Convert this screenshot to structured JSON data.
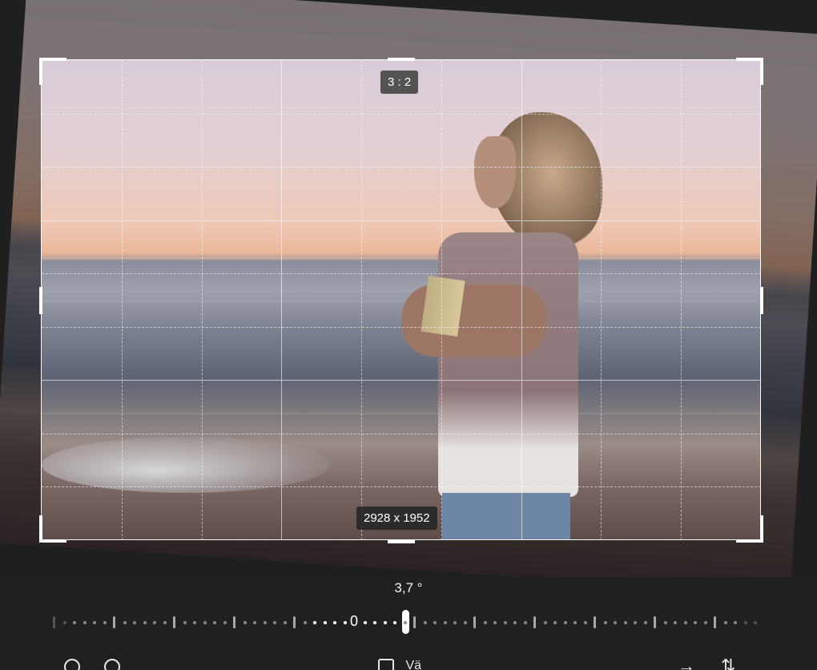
{
  "crop": {
    "aspect_ratio": "3 : 2",
    "dimensions": "2928 x 1952"
  },
  "straighten": {
    "angle_label": "3,7 °",
    "zero_label": "0",
    "angle_value": 3.7
  },
  "toolbar": {
    "rotate_left_icon": "rotate-left-icon",
    "rotate_right_icon": "rotate-right-icon",
    "aspect_icon": "aspect-ratio-icon",
    "aspect_label": "Vä",
    "flip_horizontal_icon": "flip-horizontal-icon",
    "flip_vertical_icon": "flip-vertical-icon"
  },
  "colors": {
    "background": "#202020",
    "accent": "#ffffff"
  }
}
